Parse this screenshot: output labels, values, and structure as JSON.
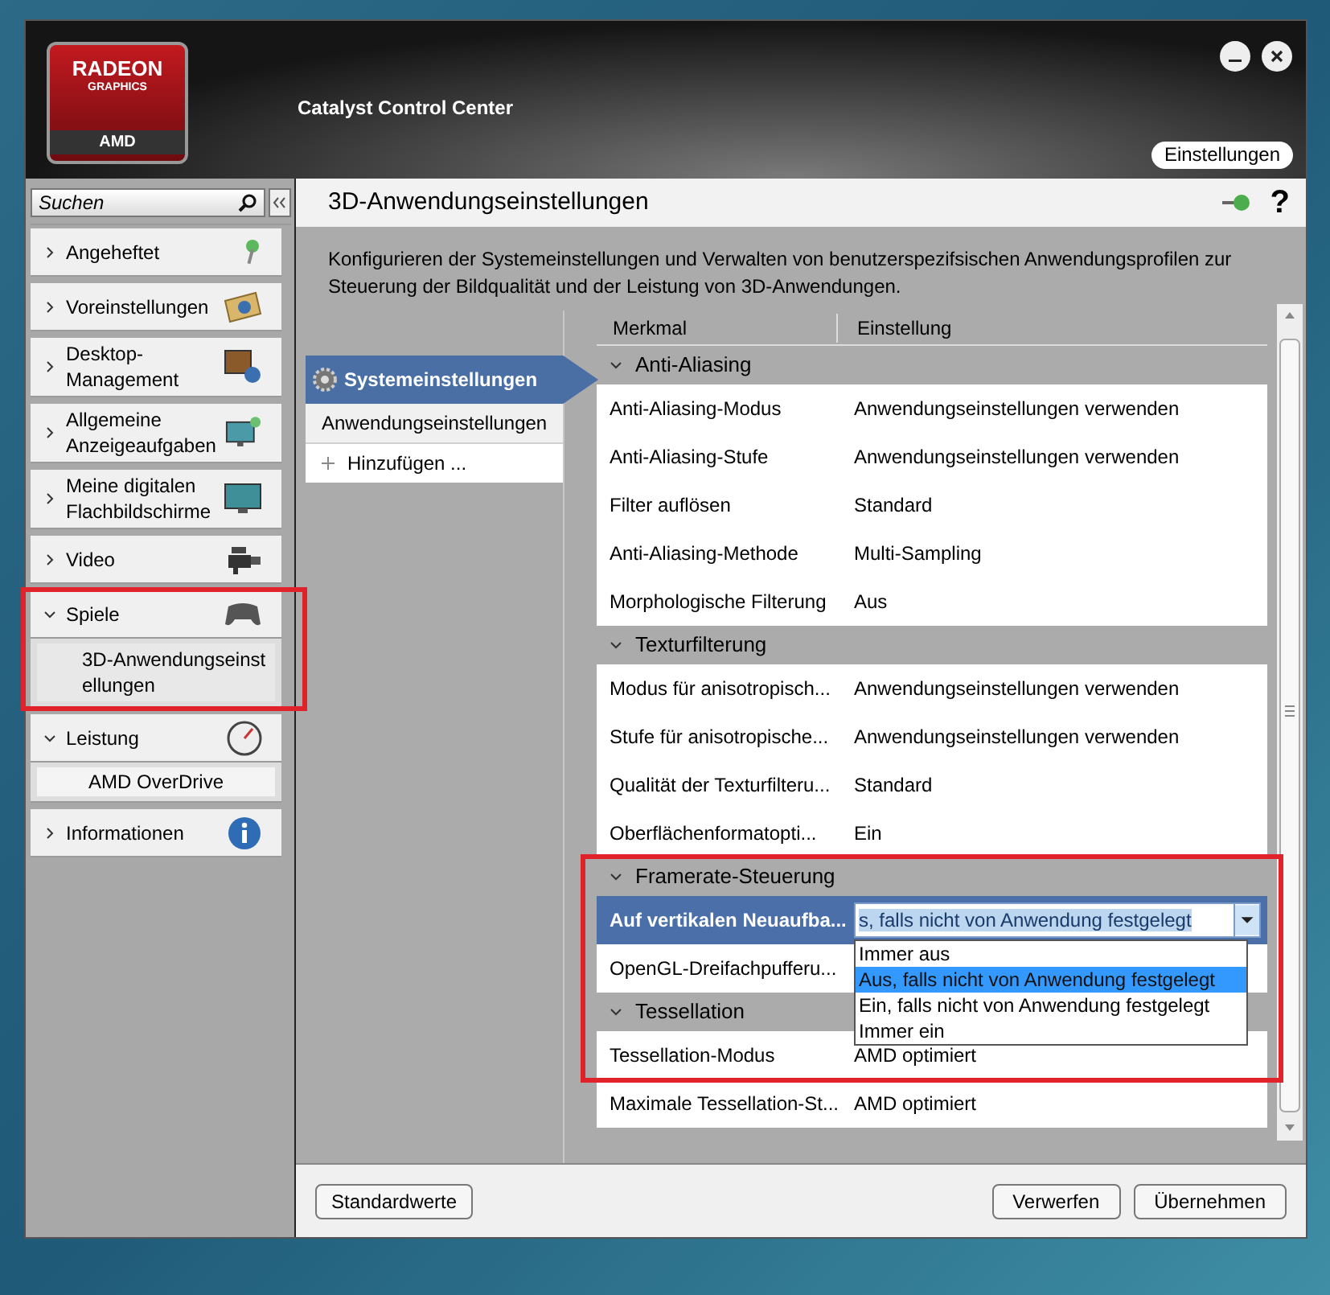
{
  "header": {
    "logo": {
      "line1": "RADEON",
      "line2": "GRAPHICS",
      "line3": "AMD"
    },
    "title": "Catalyst Control Center",
    "settings_button": "Einstellungen"
  },
  "sidebar": {
    "search": {
      "placeholder": "Suchen"
    },
    "items": [
      {
        "label": "Angeheftet",
        "expanded": false,
        "highlighted": false
      },
      {
        "label": "Voreinstellungen",
        "expanded": false,
        "highlighted": false
      },
      {
        "label": "Desktop-Management",
        "expanded": false,
        "highlighted": false
      },
      {
        "label": "Allgemeine Anzeigeaufgaben",
        "expanded": false,
        "highlighted": false
      },
      {
        "label": "Meine digitalen Flachbildschirme",
        "expanded": false,
        "highlighted": false
      },
      {
        "label": "Video",
        "expanded": false,
        "highlighted": false
      },
      {
        "label": "Spiele",
        "expanded": true,
        "highlighted": true,
        "children": [
          {
            "label": "3D-Anwendungseinstellungen",
            "selected": true
          }
        ]
      },
      {
        "label": "Leistung",
        "expanded": true,
        "highlighted": false,
        "children": [
          {
            "label": "AMD OverDrive",
            "selected": false
          }
        ]
      },
      {
        "label": "Informationen",
        "expanded": false,
        "highlighted": false
      }
    ]
  },
  "page": {
    "title": "3D-Anwendungseinstellungen",
    "help": "?",
    "description": "Konfigurieren der Systemeinstellungen und Verwalten von benutzerspezifsischen Anwendungsprofilen zur Steuerung der Bildqualität und der Leistung von 3D-Anwendungen.",
    "profiles": [
      {
        "label": "Systemeinstellungen",
        "selected": true,
        "kind": "system"
      },
      {
        "label": "Anwendungseinstellungen",
        "selected": false,
        "kind": "plain"
      },
      {
        "label": "Hinzufügen ...",
        "selected": false,
        "kind": "add"
      }
    ],
    "table": {
      "columns": [
        "Merkmal",
        "Einstellung"
      ],
      "sections": [
        {
          "title": "Anti-Aliasing",
          "expanded": true,
          "highlighted": false,
          "rows": [
            {
              "name": "Anti-Aliasing-Modus",
              "value": "Anwendungseinstellungen verwenden",
              "selected": false
            },
            {
              "name": "Anti-Aliasing-Stufe",
              "value": "Anwendungseinstellungen verwenden",
              "selected": false
            },
            {
              "name": "Filter auflösen",
              "value": "Standard",
              "selected": false
            },
            {
              "name": "Anti-Aliasing-Methode",
              "value": "Multi-Sampling",
              "selected": false
            },
            {
              "name": "Morphologische Filterung",
              "value": "Aus",
              "selected": false
            }
          ]
        },
        {
          "title": "Texturfilterung",
          "expanded": true,
          "highlighted": false,
          "rows": [
            {
              "name": "Modus für anisotropisch...",
              "value": "Anwendungseinstellungen verwenden",
              "selected": false
            },
            {
              "name": "Stufe für anisotropische...",
              "value": "Anwendungseinstellungen verwenden",
              "selected": false
            },
            {
              "name": "Qualität der Texturfilteru...",
              "value": "Standard",
              "selected": false
            },
            {
              "name": "Oberflächenformatopti...",
              "value": "Ein",
              "selected": false
            }
          ]
        },
        {
          "title": "Framerate-Steuerung",
          "expanded": true,
          "highlighted": true,
          "rows": [
            {
              "name": "Auf vertikalen Neuaufba...",
              "selected": true,
              "combo": {
                "value": "s, falls nicht von Anwendung festgelegt",
                "expanded": true,
                "options": [
                  {
                    "label": "Immer aus",
                    "selected": false
                  },
                  {
                    "label": "Aus, falls nicht von Anwendung festgelegt",
                    "selected": true
                  },
                  {
                    "label": "Ein, falls nicht von Anwendung festgelegt",
                    "selected": false
                  },
                  {
                    "label": "Immer ein",
                    "selected": false
                  }
                ]
              }
            },
            {
              "name": "OpenGL-Dreifachpufferu...",
              "selected": false
            }
          ]
        },
        {
          "title": "Tessellation",
          "expanded": true,
          "highlighted": false,
          "rows": [
            {
              "name": "Tessellation-Modus",
              "value": "AMD optimiert",
              "selected": false
            },
            {
              "name": "Maximale Tessellation-St...",
              "value": "AMD optimiert",
              "selected": false
            }
          ]
        }
      ]
    }
  },
  "footer": {
    "left_buttons": [
      "Standardwerte"
    ],
    "right_buttons": [
      "Verwerfen",
      "Übernehmen"
    ]
  }
}
